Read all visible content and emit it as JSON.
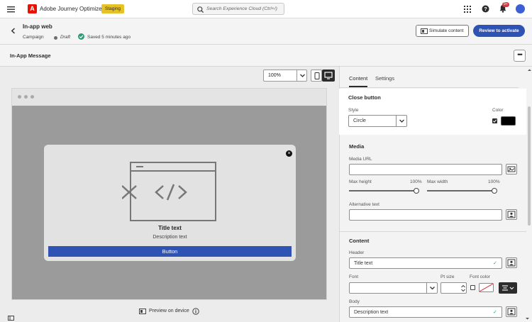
{
  "topbar": {
    "app_name": "Adobe Journey Optimizer",
    "logo_letter": "A",
    "env_badge": "Staging",
    "search_placeholder": "Search Experience Cloud (Ctrl+/)",
    "notification_count": "9+"
  },
  "header": {
    "title": "In-app web",
    "type": "Campaign",
    "status": "Draft",
    "saved_text": "Saved 5 minutes ago",
    "simulate_label": "Simulate content",
    "review_label": "Review to activate"
  },
  "editor": {
    "title": "In-App Message",
    "more_label": "•••",
    "zoom": "100%"
  },
  "preview": {
    "title": "Title text",
    "description": "Description text",
    "button_label": "Button",
    "preview_on_device": "Preview on device"
  },
  "panel": {
    "tabs": [
      "Content",
      "Settings"
    ],
    "close_button": {
      "heading": "Close button",
      "style_label": "Style",
      "style_value": "Circle",
      "color_label": "Color",
      "color_value": "#000000"
    },
    "media": {
      "heading": "Media",
      "url_label": "Media URL",
      "max_height_label": "Max height",
      "max_height_value": "100%",
      "max_width_label": "Max width",
      "max_width_value": "100%",
      "alt_label": "Alternative text"
    },
    "content": {
      "heading": "Content",
      "header_label": "Header",
      "header_value": "Title text",
      "font_label": "Font",
      "pt_size_label": "Pt size",
      "font_color_label": "Font color",
      "body_label": "Body",
      "body_value": "Description text"
    }
  },
  "colors": {
    "accent": "#2e53b5",
    "staging": "#e6c229",
    "success": "#2d9d78",
    "adobe_red": "#eb1000"
  }
}
